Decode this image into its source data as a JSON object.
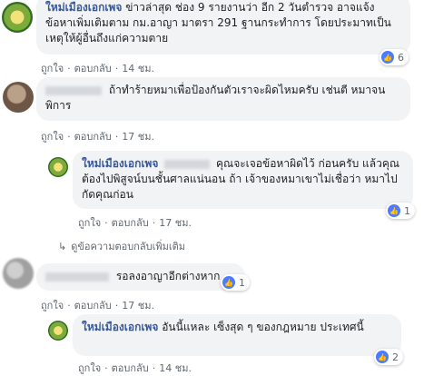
{
  "comments": [
    {
      "author": "ใหม่เมืองเอกเพจ",
      "text": "ข่าวล่าสุด ช่อง 9 รายงานว่า อีก 2 วันตำรวจ อาจแจ้งข้อหาเพิ่มเติมตาม กม.อาญา มาตรา 291 ฐานกระทำการ โดยประมาทเป็นเหตุให้ผู้อื่นถึงแก่ความตาย",
      "like": "ถูกใจ",
      "reply": "ตอบกลับ",
      "time": "14 ชม.",
      "reactions": "6"
    },
    {
      "author": "",
      "text": "ถ้าทำร้ายหมาเพื่อป้องกันตัวเราจะผิดไหมครับ เช่นตี หมาจนพิการ",
      "like": "ถูกใจ",
      "reply": "ตอบกลับ",
      "time": "17 ชม."
    },
    {
      "author": "ใหม่เมืองเอกเพจ",
      "text": "คุณจะเจอข้อหาผิดไว้ ก่อนครับ แล้วคุณต้องไปพิสูจน์บนชั้นศาลแน่นอน ถ้า เจ้าของหมาเขาไม่เชื่อว่า หมาไปกัดคุณก่อน",
      "like": "ถูกใจ",
      "reply": "ตอบกลับ",
      "time": "17 ชม.",
      "reactions": "1"
    },
    {
      "author": "",
      "text": "รอลงอาญาอีกต่างหาก",
      "like": "ถูกใจ",
      "reply": "ตอบกลับ",
      "time": "17 ชม.",
      "reactions": "1"
    },
    {
      "author": "ใหม่เมืองเอกเพจ",
      "text": "อันนี้แหละ เซ็งสุด ๆ ของกฎหมาย ประเทศนี้",
      "like": "ถูกใจ",
      "reply": "ตอบกลับ",
      "time": "14 ชม.",
      "reactions": "2"
    }
  ],
  "more_replies": "ดูข้อความตอบกลับเพิ่มเติม",
  "icons": {
    "like": "thumbs-up-icon",
    "reply_arrow": "reply-arrow-icon"
  },
  "colors": {
    "author": "#385898",
    "bubble": "#f2f3f5",
    "like_badge": "#4a7cff"
  }
}
